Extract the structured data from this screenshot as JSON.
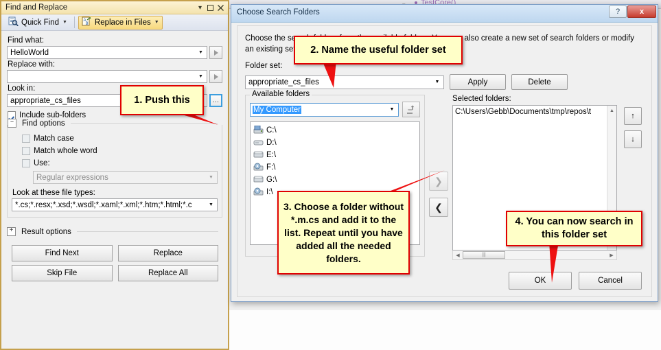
{
  "background": {
    "code_label": "TestCore()"
  },
  "find_replace": {
    "title": "Find and Replace",
    "titlebar_icons": [
      "chevron-down-icon",
      "maximize-icon",
      "close-icon"
    ],
    "toolbar": {
      "quick_find": "Quick Find",
      "replace_in_files": "Replace in Files"
    },
    "find_what_label": "Find what:",
    "find_what_value": "HelloWorld",
    "replace_with_label": "Replace with:",
    "replace_with_value": "",
    "look_in_label": "Look in:",
    "look_in_value": "appropriate_cs_files",
    "browse_label": "...",
    "include_subfolders": "Include sub-folders",
    "include_subfolders_checked": true,
    "find_options_title": "Find options",
    "find_options_expander": "–",
    "options": [
      {
        "label": "Match case",
        "checked": false
      },
      {
        "label": "Match whole word",
        "checked": false
      },
      {
        "label": "Use:",
        "checked": false
      }
    ],
    "use_value": "Regular expressions",
    "file_types_label": "Look at these file types:",
    "file_types_value": "*.cs;*.resx;*.xsd;*.wsdl;*.xaml;*.xml;*.htm;*.html;*.c",
    "result_options_title": "Result options",
    "result_options_expander": "+",
    "buttons": [
      "Find Next",
      "Replace",
      "Skip File",
      "Replace All"
    ]
  },
  "dialog": {
    "title": "Choose Search Folders",
    "help_label": "?",
    "close_label": "x",
    "description": "Choose the search folders from the available folders. You may also create a new set of search folders or modify an existing set.",
    "folder_set_label": "Folder set:",
    "folder_set_value": "appropriate_cs_files",
    "apply_label": "Apply",
    "delete_label": "Delete",
    "available": {
      "group_label": "Available folders",
      "location_value": "My Computer",
      "up_icon": "up-one-level-icon",
      "drives": [
        "C:\\",
        "D:\\",
        "E:\\",
        "F:\\",
        "G:\\",
        "I:\\"
      ]
    },
    "transfer": {
      "add_label": "❯",
      "remove_label": "❮"
    },
    "selected": {
      "label": "Selected folders:",
      "items": [
        "C:\\Users\\Gebb\\Documents\\tmp\\repos\\t"
      ],
      "move_up_label": "↑",
      "move_down_label": "↓"
    },
    "ok_label": "OK",
    "cancel_label": "Cancel"
  },
  "callouts": {
    "one": "1. Push this",
    "two": "2. Name the useful folder set",
    "three": "3. Choose a folder without *.m.cs and add it to the list. Repeat until you have added all the needed folders.",
    "four": "4. You can now search in this folder set"
  },
  "colors": {
    "callout_bg": "#ffffc8",
    "callout_border": "#e00000",
    "accent": "#3399ff"
  }
}
